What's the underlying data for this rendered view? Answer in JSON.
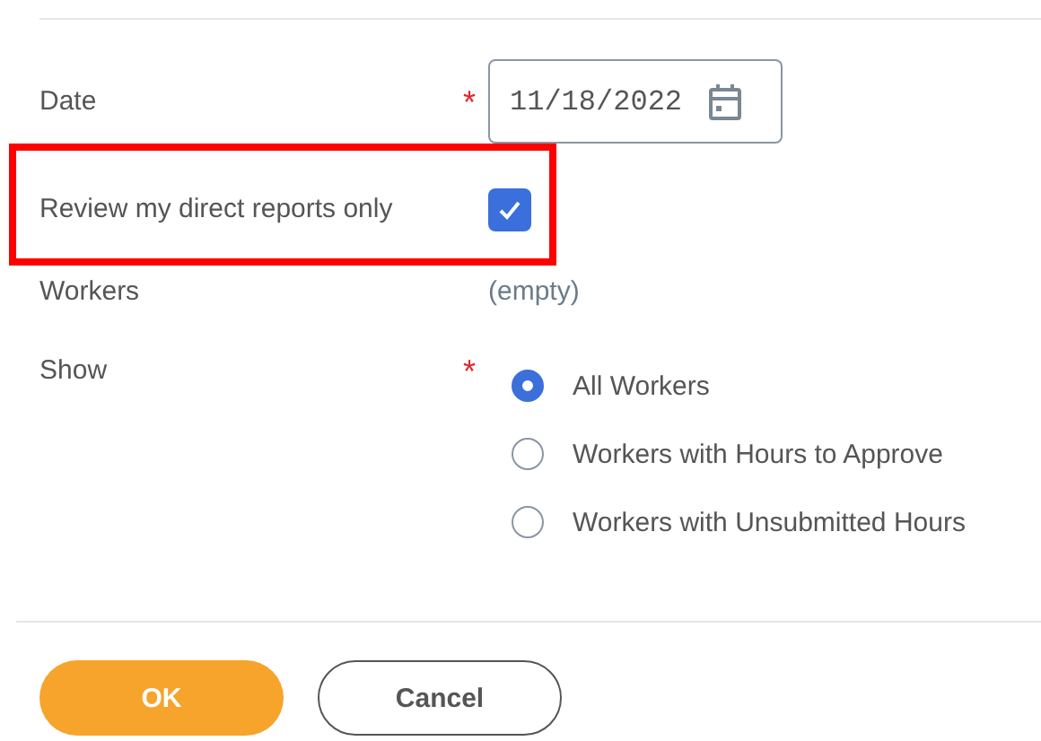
{
  "fields": [
    {
      "kind": "date",
      "label": "Date",
      "required_mark": "*",
      "value": "11/18/2022"
    },
    {
      "kind": "checkbox",
      "label": "Review my direct reports only",
      "checked": true,
      "highlighted": true
    },
    {
      "kind": "text",
      "label": "Workers",
      "value": "(empty)"
    },
    {
      "kind": "radio",
      "label": "Show",
      "required_mark": "*",
      "options": [
        {
          "label": "All Workers",
          "selected": true
        },
        {
          "label": "Workers with Hours to Approve",
          "selected": false
        },
        {
          "label": "Workers with Unsubmitted Hours",
          "selected": false
        }
      ]
    }
  ],
  "buttons": [
    {
      "label": "OK",
      "kind": "primary"
    },
    {
      "label": "Cancel",
      "kind": "secondary"
    }
  ]
}
